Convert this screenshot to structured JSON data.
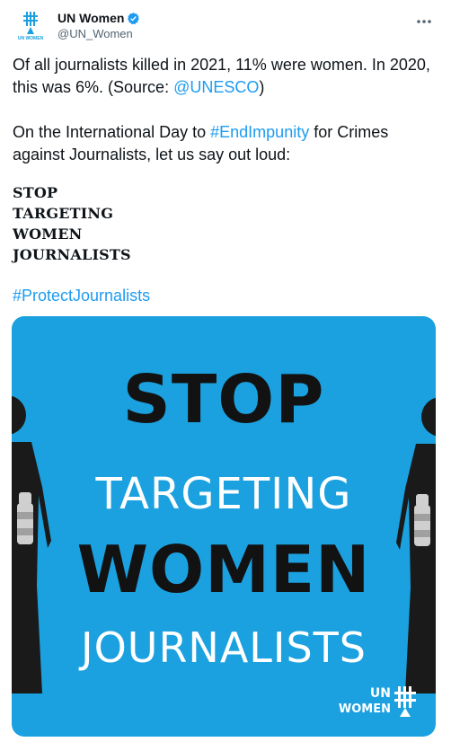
{
  "account": {
    "name": "UN Women",
    "handle": "@UN_Women",
    "avatar_caption": "UN WOMEN"
  },
  "tweet": {
    "line1_pre": "Of all journalists killed in 2021, 11% were women. In 2020, this was 6%. (Source: ",
    "line1_link": "@UNESCO",
    "line1_post": ")",
    "line2_pre": "On the International Day to ",
    "line2_link": "#EndImpunity",
    "line2_post": " for Crimes against Journalists, let us say out loud:",
    "bold_lines": [
      "STOP",
      "TARGETING",
      "WOMEN",
      "JOURNALISTS"
    ],
    "hashtag": "#ProtectJournalists"
  },
  "media": {
    "lines": [
      "STOP",
      "TARGETING",
      "WOMEN",
      "JOURNALISTS"
    ],
    "logo_line1": "UN",
    "logo_line2": "WOMEN",
    "background_color": "#1ba1df"
  },
  "icons": {
    "verified": "verified-badge-icon",
    "more": "more-options-icon"
  },
  "colors": {
    "link": "#1d9bf0",
    "text": "#0f1419",
    "secondary": "#536471"
  }
}
